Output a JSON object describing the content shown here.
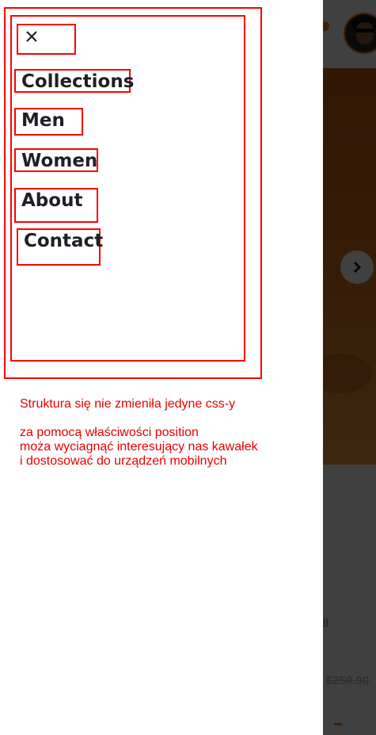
{
  "menu": {
    "close_label": "×",
    "items": [
      {
        "label": "Collections"
      },
      {
        "label": "Men"
      },
      {
        "label": "Women"
      },
      {
        "label": "About"
      },
      {
        "label": "Contact"
      }
    ]
  },
  "annotation": {
    "line1": "Struktura się nie zmieniła jedyne css-y",
    "line2": "za pomocą właściwości position",
    "line3": "moża wyciagnąć interesujący nas kawałek",
    "line4": "i dostosować do urządzeń mobilnych"
  },
  "background": {
    "next_icon": "chevron-right-icon",
    "product_fragment": "ll",
    "old_price": "$250.00"
  },
  "colors": {
    "accent": "#ff7d1a",
    "outline": "#ff0000",
    "annotation_text": "#e60000",
    "menu_text": "#1d2026",
    "overlay": "rgba(0,0,0,0.75)"
  }
}
